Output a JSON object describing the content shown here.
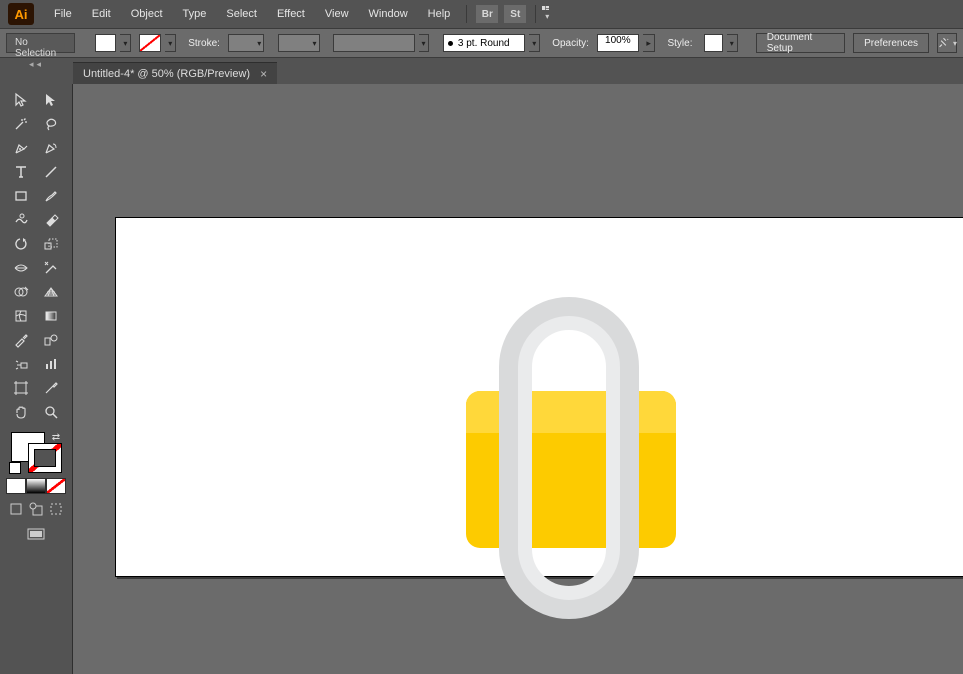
{
  "app": {
    "logo_text": "Ai"
  },
  "menu": {
    "file": "File",
    "edit": "Edit",
    "object": "Object",
    "type": "Type",
    "select": "Select",
    "effect": "Effect",
    "view": "View",
    "window": "Window",
    "help": "Help"
  },
  "titlebar_icons": {
    "br": "Br",
    "st": "St"
  },
  "options": {
    "selection_state": "No Selection",
    "stroke_label": "Stroke:",
    "brush_label": "3 pt. Round",
    "opacity_label": "Opacity:",
    "opacity_value": "100%",
    "style_label": "Style:",
    "doc_setup_btn": "Document Setup",
    "preferences_btn": "Preferences"
  },
  "document": {
    "tab_title": "Untitled-4* @ 50% (RGB/Preview)",
    "tab_close": "×"
  },
  "toolbox_collapse": "◂◂",
  "tools": [
    [
      "selection",
      "direct-selection"
    ],
    [
      "magic-wand",
      "lasso"
    ],
    [
      "pen",
      "curvature-pen"
    ],
    [
      "type",
      "line-segment"
    ],
    [
      "rectangle",
      "paintbrush"
    ],
    [
      "shaper",
      "eraser"
    ],
    [
      "rotate",
      "scale"
    ],
    [
      "width",
      "free-transform"
    ],
    [
      "shape-builder",
      "perspective-grid"
    ],
    [
      "mesh",
      "gradient"
    ],
    [
      "eyedropper",
      "blend"
    ],
    [
      "symbol-sprayer",
      "column-graph"
    ],
    [
      "artboard",
      "slice"
    ],
    [
      "hand",
      "zoom"
    ]
  ]
}
